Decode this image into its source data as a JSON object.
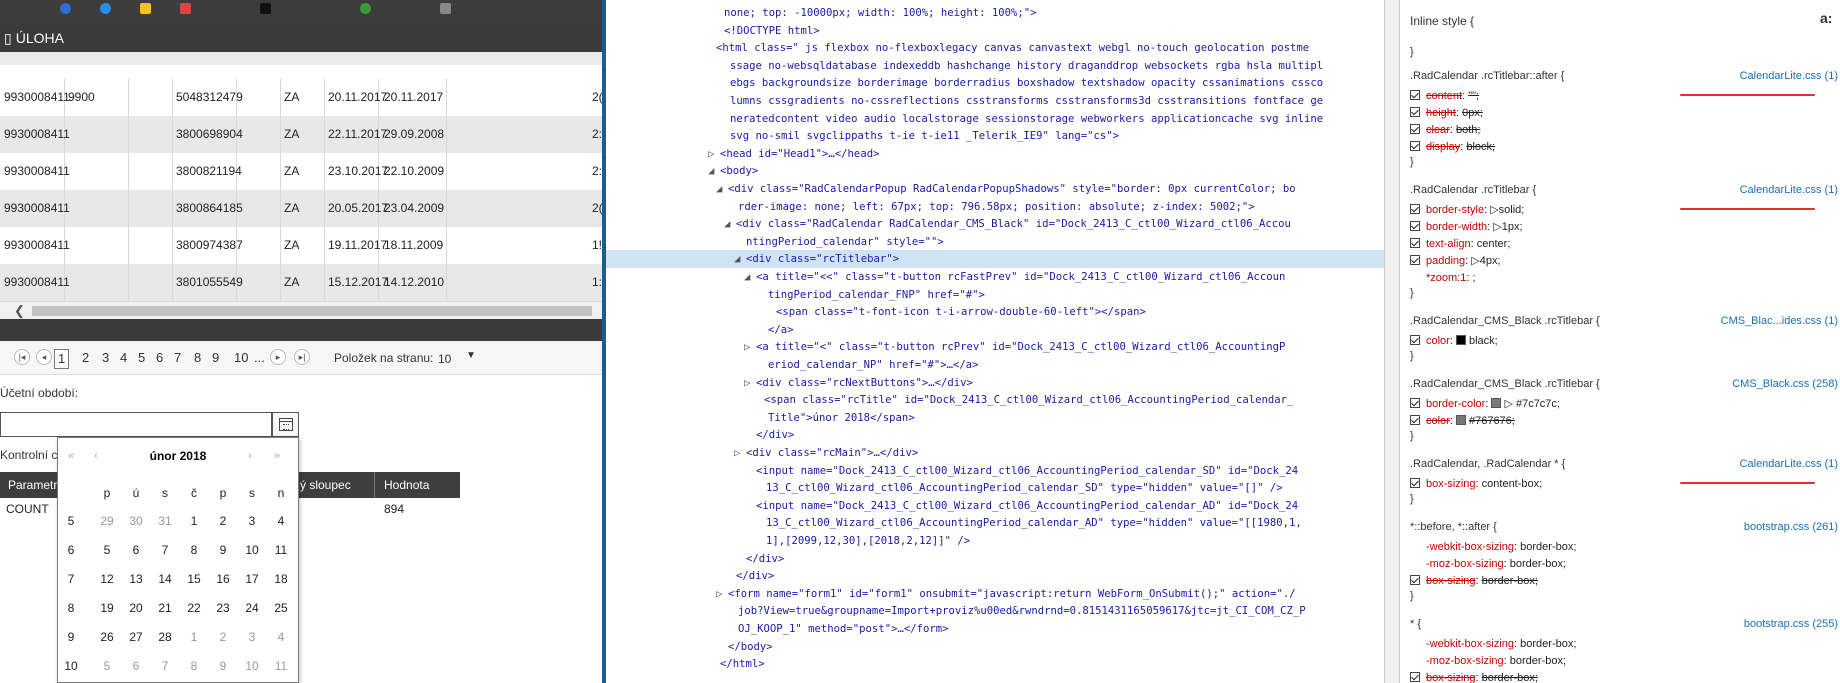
{
  "app": {
    "header_title": "ÚLOHA",
    "grid_rows": [
      {
        "c1": "9930008411",
        "c2": "9900",
        "c3": "5048312479",
        "c4": "ZA",
        "c5": "20.11.2017",
        "c6": "20.11.2017",
        "c7": "2("
      },
      {
        "c1": "9930008411",
        "c2": "",
        "c3": "3800698904",
        "c4": "ZA",
        "c5": "22.11.2017",
        "c6": "29.09.2008",
        "c7": "2:"
      },
      {
        "c1": "9930008411",
        "c2": "",
        "c3": "3800821194",
        "c4": "ZA",
        "c5": "23.10.2017",
        "c6": "22.10.2009",
        "c7": "2:"
      },
      {
        "c1": "9930008411",
        "c2": "",
        "c3": "3800864185",
        "c4": "ZA",
        "c5": "20.05.2017",
        "c6": "23.04.2009",
        "c7": "2("
      },
      {
        "c1": "9930008411",
        "c2": "",
        "c3": "3800974387",
        "c4": "ZA",
        "c5": "19.11.2017",
        "c6": "18.11.2009",
        "c7": "1!"
      },
      {
        "c1": "9930008411",
        "c2": "",
        "c3": "3801055549",
        "c4": "ZA",
        "c5": "15.12.2017",
        "c6": "14.12.2010",
        "c7": "1:"
      }
    ],
    "pager": {
      "pages": [
        "1",
        "2",
        "3",
        "4",
        "5",
        "6",
        "7",
        "8",
        "9",
        "10",
        "..."
      ],
      "per_page_label": "Položek na stranu:",
      "per_page_value": "10"
    },
    "accounting_period_label": "Účetní období:",
    "date_value": "",
    "control_label": "Kontrolní c",
    "param_table": {
      "headers": [
        "Parametr",
        "ý sloupec",
        "Hodnota"
      ],
      "row": {
        "param": "COUNT",
        "value": "894"
      }
    },
    "calendar": {
      "title": "únor 2018",
      "nav_fast_prev": "«",
      "nav_prev": "‹",
      "nav_next": "›",
      "nav_fast_next": "»",
      "weekdays": [
        "p",
        "ú",
        "s",
        "č",
        "p",
        "s",
        "n"
      ],
      "weeks": [
        {
          "wk": "5",
          "days": [
            "29",
            "30",
            "31",
            "1",
            "2",
            "3",
            "4"
          ],
          "other": [
            true,
            true,
            true,
            false,
            false,
            false,
            false
          ]
        },
        {
          "wk": "6",
          "days": [
            "5",
            "6",
            "7",
            "8",
            "9",
            "10",
            "11"
          ],
          "other": [
            false,
            false,
            false,
            false,
            false,
            false,
            false
          ]
        },
        {
          "wk": "7",
          "days": [
            "12",
            "13",
            "14",
            "15",
            "16",
            "17",
            "18"
          ],
          "other": [
            false,
            false,
            false,
            false,
            false,
            false,
            false
          ]
        },
        {
          "wk": "8",
          "days": [
            "19",
            "20",
            "21",
            "22",
            "23",
            "24",
            "25"
          ],
          "other": [
            false,
            false,
            false,
            false,
            false,
            false,
            false
          ]
        },
        {
          "wk": "9",
          "days": [
            "26",
            "27",
            "28",
            "1",
            "2",
            "3",
            "4"
          ],
          "other": [
            false,
            false,
            false,
            true,
            true,
            true,
            true
          ]
        },
        {
          "wk": "10",
          "days": [
            "5",
            "6",
            "7",
            "8",
            "9",
            "10",
            "11"
          ],
          "other": [
            true,
            true,
            true,
            true,
            true,
            true,
            true
          ]
        }
      ]
    }
  },
  "dom_lines": [
    "none; top: -10000px; width: 100%; height: 100%;\">",
    "<!DOCTYPE html>",
    "<html class=\" js flexbox no-flexboxlegacy canvas canvastext webgl no-touch geolocation postme",
    "ssage no-websqldatabase indexeddb hashchange history draganddrop websockets rgba hsla multipl",
    "ebgs backgroundsize borderimage borderradius boxshadow textshadow opacity cssanimations cssco",
    "lumns cssgradients no-cssreflections csstransforms csstransforms3d csstransitions fontface ge",
    "neratedcontent video audio localstorage sessionstorage webworkers applicationcache svg inline",
    "svg no-smil svgclippaths t-ie t-ie11 _Telerik_IE9\" lang=\"cs\">",
    "<head id=\"Head1\">…</head>",
    "<body>",
    "<div class=\"RadCalendarPopup RadCalendarPopupShadows\" style=\"border: 0px currentColor; bo",
    "rder-image: none; left: 67px; top: 796.58px; position: absolute; z-index: 5002;\">",
    "<div class=\"RadCalendar RadCalendar_CMS_Black\" id=\"Dock_2413_C_ctl00_Wizard_ctl06_Accou",
    "ntingPeriod_calendar\" style=\"\">",
    "<div class=\"rcTitlebar\">",
    "<a title=\"<<\" class=\"t-button rcFastPrev\" id=\"Dock_2413_C_ctl00_Wizard_ctl06_Accoun",
    "tingPeriod_calendar_FNP\" href=\"#\">",
    "<span class=\"t-font-icon t-i-arrow-double-60-left\"></span>",
    "</a>",
    "<a title=\"<\" class=\"t-button rcPrev\" id=\"Dock_2413_C_ctl00_Wizard_ctl06_AccountingP",
    "eriod_calendar_NP\" href=\"#\">…</a>",
    "<div class=\"rcNextButtons\">…</div>",
    "<span class=\"rcTitle\" id=\"Dock_2413_C_ctl00_Wizard_ctl06_AccountingPeriod_calendar_",
    "Title\">únor 2018</span>",
    "</div>",
    "<div class=\"rcMain\">…</div>",
    "<input name=\"Dock_2413_C_ctl00_Wizard_ctl06_AccountingPeriod_calendar_SD\" id=\"Dock_24",
    "13_C_ctl00_Wizard_ctl06_AccountingPeriod_calendar_SD\" type=\"hidden\" value=\"[]\" />",
    "<input name=\"Dock_2413_C_ctl00_Wizard_ctl06_AccountingPeriod_calendar_AD\" id=\"Dock_24",
    "13_C_ctl00_Wizard_ctl06_AccountingPeriod_calendar_AD\" type=\"hidden\" value=\"[[1980,1,",
    "1],[2099,12,30],[2018,2,12]]\" />",
    "</div>",
    "</div>",
    "<form name=\"form1\" id=\"form1\" onsubmit=\"javascript:return WebForm_OnSubmit();\" action=\"./",
    "job?View=true&groupname=Import+proviz%u00ed&rwndrnd=0.8151431165059617&jtc=jt_CI_COM_CZ_P",
    "OJ_KOOP_1\" method=\"post\">…</form>",
    "</body>",
    "</html>"
  ],
  "styles": {
    "inline_header": "Inline style  {",
    "aa_label": "a:",
    "rules": [
      {
        "selector": ".RadCalendar .rcTitlebar::after  {",
        "source": "CalendarLite.css (1)",
        "props": [
          {
            "name": "content",
            "value": "\"\";",
            "on": true,
            "strike": true
          },
          {
            "name": "height",
            "value": "0px;",
            "on": true,
            "strike": true
          },
          {
            "name": "clear",
            "value": "both;",
            "on": true,
            "strike": true
          },
          {
            "name": "display",
            "value": "block;",
            "on": true,
            "strike": true
          }
        ]
      },
      {
        "selector": ".RadCalendar .rcTitlebar  {",
        "source": "CalendarLite.css (1)",
        "props": [
          {
            "name": "border-style",
            "value": "▷solid;",
            "on": true,
            "strike": false
          },
          {
            "name": "border-width",
            "value": "▷1px;",
            "on": true,
            "strike": false
          },
          {
            "name": "text-align",
            "value": "center;",
            "on": true,
            "strike": false
          },
          {
            "name": "padding",
            "value": "▷4px;",
            "on": true,
            "strike": false
          },
          {
            "name": "*zoom:1",
            "value": ";",
            "on": false,
            "strike": false
          }
        ]
      },
      {
        "selector": ".RadCalendar_CMS_Black .rcTitlebar  {",
        "source": "CMS_Blac...ides.css (1)",
        "props": [
          {
            "name": "color",
            "value": "black;",
            "on": true,
            "strike": false,
            "swatch": "#000000"
          }
        ]
      },
      {
        "selector": ".RadCalendar_CMS_Black .rcTitlebar  {",
        "source": "CMS_Black.css (258)",
        "props": [
          {
            "name": "border-color",
            "value": "▷ #7c7c7c;",
            "on": true,
            "strike": false,
            "swatch": "#7c7c7c"
          },
          {
            "name": "color",
            "value": "#767676;",
            "on": true,
            "strike": true,
            "swatch": "#767676"
          }
        ]
      },
      {
        "selector": ".RadCalendar, .RadCalendar *  {",
        "source": "CalendarLite.css (1)",
        "props": [
          {
            "name": "box-sizing",
            "value": "content-box;",
            "on": true,
            "strike": false
          }
        ]
      },
      {
        "selector": "*::before, *::after  {",
        "source": "bootstrap.css (261)",
        "props": [
          {
            "name": "-webkit-box-sizing",
            "value": "border-box;",
            "on": false,
            "strike": false
          },
          {
            "name": "-moz-box-sizing",
            "value": "border-box;",
            "on": false,
            "strike": false
          },
          {
            "name": "box-sizing",
            "value": "border-box;",
            "on": true,
            "strike": true
          }
        ]
      },
      {
        "selector": "*  {",
        "source": "bootstrap.css (255)",
        "props": [
          {
            "name": "-webkit-box-sizing",
            "value": "border-box;",
            "on": false,
            "strike": false
          },
          {
            "name": "-moz-box-sizing",
            "value": "border-box;",
            "on": false,
            "strike": false
          },
          {
            "name": "box-sizing",
            "value": "border-box;",
            "on": true,
            "strike": true
          }
        ]
      }
    ]
  }
}
